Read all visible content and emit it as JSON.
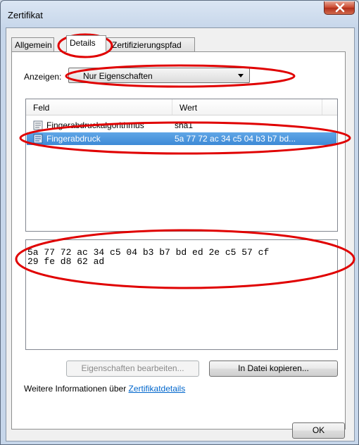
{
  "window": {
    "title": "Zertifikat"
  },
  "tabs": [
    {
      "label": "Allgemein"
    },
    {
      "label": "Details"
    },
    {
      "label": "Zertifizierungspfad"
    }
  ],
  "filter": {
    "label": "Anzeigen:",
    "selected": "Nur Eigenschaften"
  },
  "fields_list": {
    "columns": [
      "Feld",
      "Wert"
    ],
    "rows": [
      {
        "field": "Fingerabdruckalgorithmus",
        "value": "sha1"
      },
      {
        "field": "Fingerabdruck",
        "value": "5a 77 72 ac 34 c5 04 b3 b7 bd..."
      }
    ]
  },
  "value_box": {
    "text": "5a 77 72 ac 34 c5 04 b3 b7 bd ed 2e c5 57 cf\n29 fe d8 62 ad"
  },
  "buttons": {
    "edit_properties": "Eigenschaften bearbeiten...",
    "copy_to_file": "In Datei kopieren...",
    "ok": "OK"
  },
  "info": {
    "prefix": "Weitere Informationen über ",
    "link": "Zertifikatdetails"
  },
  "colors": {
    "annotation_red": "#e00000",
    "selection": "#3d8ad6"
  }
}
